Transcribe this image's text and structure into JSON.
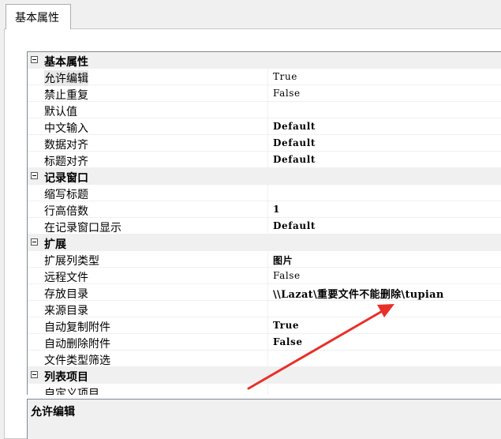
{
  "tab": {
    "label": "基本属性"
  },
  "categories": [
    {
      "name": "基本属性",
      "props": [
        {
          "name": "允许编辑",
          "value": "True",
          "bold": false,
          "selected": true
        },
        {
          "name": "禁止重复",
          "value": "False",
          "bold": false
        },
        {
          "name": "默认值",
          "value": "",
          "bold": false
        },
        {
          "name": "中文输入",
          "value": "Default",
          "bold": true
        },
        {
          "name": "数据对齐",
          "value": "Default",
          "bold": true
        },
        {
          "name": "标题对齐",
          "value": "Default",
          "bold": true
        }
      ]
    },
    {
      "name": "记录窗口",
      "props": [
        {
          "name": "缩写标题",
          "value": "",
          "bold": false
        },
        {
          "name": "行高倍数",
          "value": "1",
          "bold": true
        },
        {
          "name": "在记录窗口显示",
          "value": "Default",
          "bold": true
        }
      ]
    },
    {
      "name": "扩展",
      "props": [
        {
          "name": "扩展列类型",
          "value": "图片",
          "bold": true
        },
        {
          "name": "远程文件",
          "value": "False",
          "bold": false
        },
        {
          "name": "存放目录",
          "value": "\\\\Lazat\\重要文件不能删除\\tupian",
          "bold": true,
          "wide": true
        },
        {
          "name": "来源目录",
          "value": "",
          "bold": false
        },
        {
          "name": "自动复制附件",
          "value": "True",
          "bold": true
        },
        {
          "name": "自动删除附件",
          "value": "False",
          "bold": true
        },
        {
          "name": "文件类型筛选",
          "value": "",
          "bold": false
        }
      ]
    },
    {
      "name": "列表项目",
      "props": [
        {
          "name": "自定义项目",
          "value": "",
          "bold": false
        }
      ]
    }
  ],
  "description": {
    "title": "允许编辑"
  },
  "colors": {
    "selection": "#e8e8e8",
    "annotation_arrow": "#e8302a",
    "category_bg": "#f0f0f0"
  }
}
